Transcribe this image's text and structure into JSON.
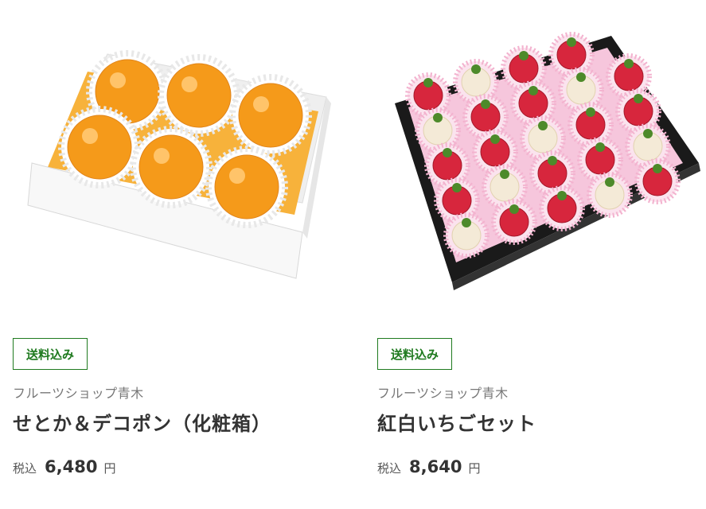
{
  "products": [
    {
      "badge": "送料込み",
      "shop": "フルーツショップ青木",
      "name": "せとか＆デコポン（化粧箱）",
      "tax_label": "税込",
      "price": "6,480",
      "currency": "円",
      "image_icon": "citrus-box-image"
    },
    {
      "badge": "送料込み",
      "shop": "フルーツショップ青木",
      "name": "紅白いちごセット",
      "tax_label": "税込",
      "price": "8,640",
      "currency": "円",
      "image_icon": "strawberry-box-image"
    }
  ],
  "colors": {
    "badge": "#1f7a1f",
    "orange": "#f59a1a",
    "strawberry_red": "#d7263d",
    "box_black": "#1a1a1a"
  }
}
